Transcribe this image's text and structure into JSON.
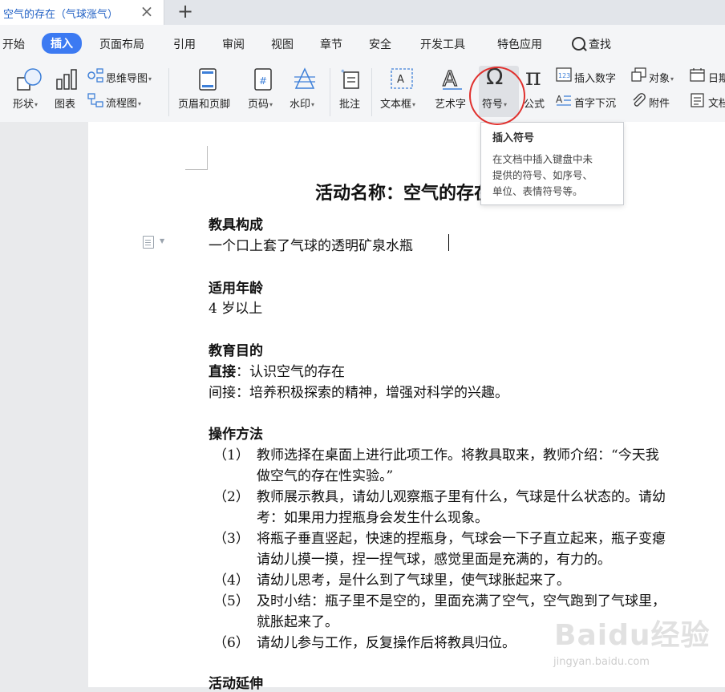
{
  "tabbar": {
    "doc_title": "空气的存在（气球涨气）",
    "close": "×",
    "new": "+"
  },
  "menu": {
    "items": [
      "开始",
      "插入",
      "页面布局",
      "引用",
      "审阅",
      "视图",
      "章节",
      "安全",
      "开发工具",
      "特色应用",
      "查找"
    ],
    "active_index": 1,
    "accent": "#3c7af2"
  },
  "ribbon": {
    "shape": "形状",
    "chart": "图表",
    "mindmap": "思维导图",
    "flowchart": "流程图",
    "header_footer": "页眉和页脚",
    "page_number": "页码",
    "watermark": "水印",
    "comment": "批注",
    "textbox": "文本框",
    "wordart": "艺术字",
    "symbol": "符号",
    "formula": "公式",
    "insert_number": "插入数字",
    "first_drop": "首字下沉",
    "object": "对象",
    "attachment": "附件",
    "date": "日期",
    "doc_part": "文档"
  },
  "tooltip": {
    "title": "插入符号",
    "lines": [
      "在文档中插入键盘中未",
      "提供的符号、如序号、",
      "单位、表情符号等。"
    ]
  },
  "document": {
    "title": "活动名称：空气的存在（气球涨气）",
    "s1_heading": "教具构成",
    "s1_text": "一个口上套了气球的透明矿泉水瓶",
    "s2_heading": "适用年龄",
    "s2_text": "4 岁以上",
    "s3_heading": "教育目的",
    "s3_direct_label": "直接",
    "s3_direct_text": "：认识空气的存在",
    "s3_indirect": "间接：培养积极探索的精神，增强对科学的兴趣。",
    "s4_heading": "操作方法",
    "steps": [
      {
        "num": "（1）",
        "lines": [
          "教师选择在桌面上进行此项工作。将教具取来，教师介绍：“今天我",
          "做空气的存在性实验。”"
        ]
      },
      {
        "num": "（2）",
        "lines": [
          "教师展示教具，请幼儿观察瓶子里有什么，气球是什么状态的。请幼",
          "考：如果用力捏瓶身会发生什么现象。"
        ]
      },
      {
        "num": "（3）",
        "lines": [
          "将瓶子垂直竖起，快速的捏瓶身，气球会一下子直立起来，瓶子变瘪",
          "请幼儿摸一摸，捏一捏气球，感觉里面是充满的，有力的。"
        ]
      },
      {
        "num": "（4）",
        "lines": [
          "请幼儿思考，是什么到了气球里，使气球胀起来了。"
        ]
      },
      {
        "num": "（5）",
        "lines": [
          "及时小结：瓶子里不是空的，里面充满了空气，空气跑到了气球里，",
          "就胀起来了。"
        ]
      },
      {
        "num": "（6）",
        "lines": [
          "请幼儿参与工作，反复操作后将教具归位。"
        ]
      }
    ],
    "s5_heading": "活动延伸"
  },
  "watermark": {
    "main": "Baidu经验",
    "sub": "jingyan.baidu.com"
  }
}
